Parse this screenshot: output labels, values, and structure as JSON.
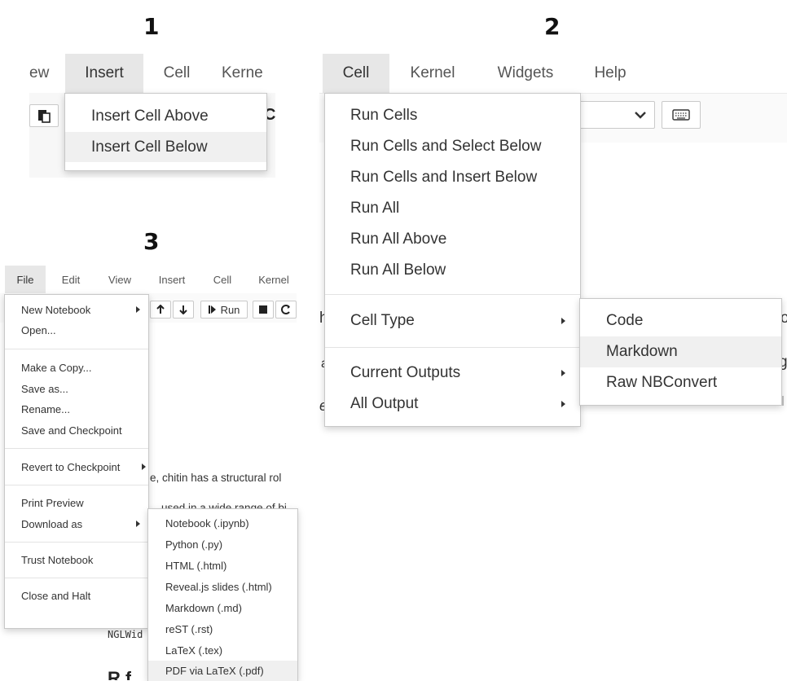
{
  "labels": {
    "step1": "1",
    "step2": "2",
    "step3": "3"
  },
  "panel1": {
    "menubar": [
      "ew",
      "Insert",
      "Cell",
      "Kerne"
    ],
    "dropdown": [
      "Insert Cell Above",
      "Insert Cell Below"
    ],
    "toolbar_fragment": "C"
  },
  "panel2": {
    "menubar": [
      "Cell",
      "Kernel",
      "Widgets",
      "Help"
    ],
    "dropdown": [
      "Run Cells",
      "Run Cells and Select Below",
      "Run Cells and Insert Below",
      "Run All",
      "Run All Above",
      "Run All Below"
    ],
    "cell_type": "Cell Type",
    "current_outputs": "Current Outputs",
    "all_output": "All Output",
    "submenu": [
      "Code",
      "Markdown",
      "Raw NBConvert"
    ],
    "bg_fragments": [
      "h",
      "a",
      "e",
      "o",
      "g"
    ]
  },
  "panel3": {
    "menubar": [
      "File",
      "Edit",
      "View",
      "Insert",
      "Cell",
      "Kernel"
    ],
    "file_menu": {
      "new_notebook": "New Notebook",
      "open": "Open...",
      "make_copy": "Make a Copy...",
      "save_as": "Save as...",
      "rename": "Rename...",
      "save_checkpoint": "Save and Checkpoint",
      "revert": "Revert to Checkpoint",
      "print_preview": "Print Preview",
      "download_as": "Download as",
      "trust": "Trust Notebook",
      "close_halt": "Close and Halt"
    },
    "download_submenu": [
      "Notebook (.ipynb)",
      "Python (.py)",
      "HTML (.html)",
      "Reveal.js slides (.html)",
      "Markdown (.md)",
      "reST (.rst)",
      "LaTeX (.tex)",
      "PDF via LaTeX (.pdf)"
    ],
    "toolbar": {
      "run": "Run"
    },
    "bg_text": {
      "line1": "e, chitin has a structural rol",
      "line2": "used in a wide range of bi",
      "code1": "NGLWid",
      "heading_frag": "R f"
    }
  }
}
